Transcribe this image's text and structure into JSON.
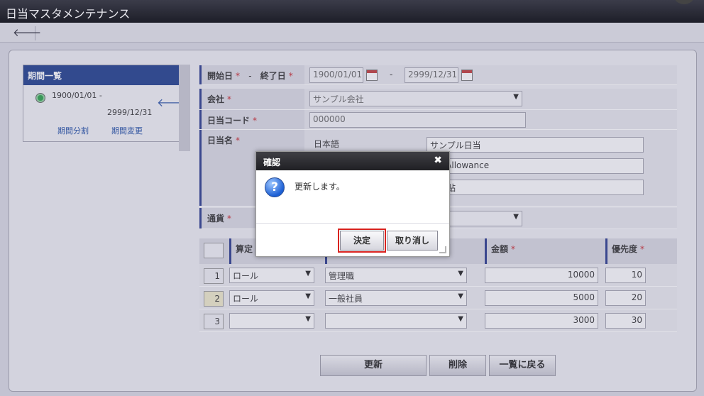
{
  "window": {
    "title": "日当マスタメンテナンス"
  },
  "toolbar": {
    "back_glyph": "🡐"
  },
  "period_list": {
    "header": "期間一覧",
    "item": {
      "start": "1900/01/01  -",
      "end": "2999/12/31"
    },
    "split_link": "期間分割",
    "change_link": "期間変更"
  },
  "form": {
    "period": {
      "label_start": "開始日",
      "separator": "-",
      "label_end": "終了日",
      "start_value": "1900/01/01",
      "end_value": "2999/12/31",
      "range_sep": "-"
    },
    "company": {
      "label": "会社",
      "value": "サンプル会社"
    },
    "code": {
      "label": "日当コード",
      "value": "000000"
    },
    "name": {
      "label": "日当名",
      "lang_ja": "日本語",
      "value_ja": "サンプル日当",
      "value_en": "ple Allowance",
      "value_zh": "日补贴"
    },
    "currency": {
      "label": "通貨"
    },
    "required_mark": "*"
  },
  "table": {
    "headers": {
      "calc": "算定",
      "amount": "金額",
      "priority": "優先度"
    },
    "rows": [
      {
        "num": "1",
        "type": "ロール",
        "target": "管理職",
        "amount": "10000",
        "priority": "10"
      },
      {
        "num": "2",
        "type": "ロール",
        "target": "一般社員",
        "amount": "5000",
        "priority": "20"
      },
      {
        "num": "3",
        "type": "",
        "target": "",
        "amount": "3000",
        "priority": "30"
      }
    ]
  },
  "actions": {
    "update": "更新",
    "delete": "削除",
    "back_to_list": "一覧に戻る"
  },
  "dialog": {
    "title": "確認",
    "close_glyph": "✖",
    "message": "更新します。",
    "ok_label": "決定",
    "cancel_label": "取り消し"
  },
  "colors": {
    "accent": "#1f3e8c",
    "required": "#c8282e",
    "focus": "#d9231f"
  }
}
